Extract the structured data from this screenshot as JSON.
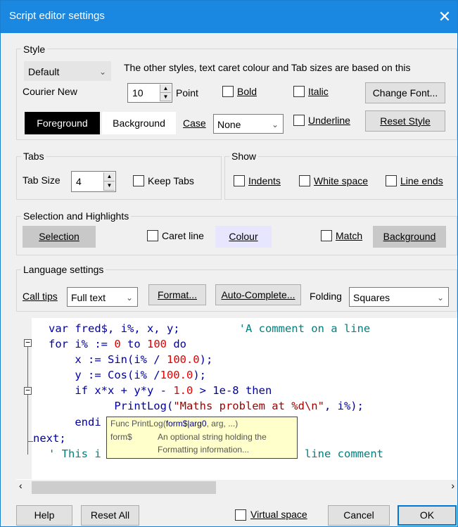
{
  "window": {
    "title": "Script editor settings",
    "close_glyph": "✕"
  },
  "style": {
    "group_title": "Style",
    "style_select": "Default",
    "info_text": "The other styles, text caret colour and Tab sizes are based on this",
    "font_name": "Courier New",
    "point_value": "10",
    "point_label": "Point",
    "bold_label": "Bold",
    "italic_label": "Italic",
    "change_font_label": "Change Font...",
    "foreground_label": "Foreground",
    "background_label": "Background",
    "case_label": "Case",
    "case_value": "None",
    "underline_label": "Underline",
    "reset_style_label": "Reset Style"
  },
  "tabs": {
    "group_title": "Tabs",
    "tab_size_label": "Tab Size",
    "tab_size_value": "4",
    "keep_tabs_label": "Keep Tabs"
  },
  "show": {
    "group_title": "Show",
    "indents_label": "Indents",
    "white_space_label": "White space",
    "line_ends_label": "Line ends"
  },
  "selection": {
    "group_title": "Selection and Highlights",
    "selection_label": "Selection",
    "caret_line_label": "Caret line",
    "colour_label": "Colour",
    "match_label": "Match",
    "background_label": "Background"
  },
  "language": {
    "group_title": "Language settings",
    "call_tips_label": "Call tips",
    "call_tips_value": "Full text",
    "format_label": "Format...",
    "autocomplete_label": "Auto-Complete...",
    "folding_label": "Folding",
    "folding_value": "Squares"
  },
  "editor": {
    "l1": [
      "var ",
      "fred$, i%, x, y;",
      "         'A comment on a line"
    ],
    "l2": [
      "for ",
      "i% := ",
      "0",
      " to ",
      "100",
      " do"
    ],
    "l3": [
      "    x := Sin(i% / ",
      "100.0",
      ");"
    ],
    "l4": [
      "    y := Cos(i% /",
      "100.0",
      ");"
    ],
    "l5": [
      "    if ",
      "x*x + y*y - ",
      "1.0",
      " > 1e-8 ",
      "then"
    ],
    "l6": [
      "          PrintLog(",
      "\"Maths problem at %d\\n\"",
      ", i%);"
    ],
    "l7": [
      "    endi"
    ],
    "l8": [
      "next;"
    ],
    "l9_a": "' This i",
    "l9_b": "line comment"
  },
  "tooltip": {
    "line1_a": "Func PrintLog(",
    "line1_b": "form$|arg0",
    "line1_c": ", arg, ...)",
    "line2_name": "form$",
    "line2_desc": "An optional string holding the",
    "line3": "Formatting information..."
  },
  "footer": {
    "help_label": "Help",
    "reset_all_label": "Reset All",
    "virtual_space_label": "Virtual space",
    "cancel_label": "Cancel",
    "ok_label": "OK"
  },
  "colors": {
    "titlebar": "#1a88e0",
    "keyword": "#00009f",
    "number": "#e60000",
    "comment": "#007f7f",
    "tooltip_bg": "#ffffcc",
    "colour_button": "#e6e6ff"
  }
}
